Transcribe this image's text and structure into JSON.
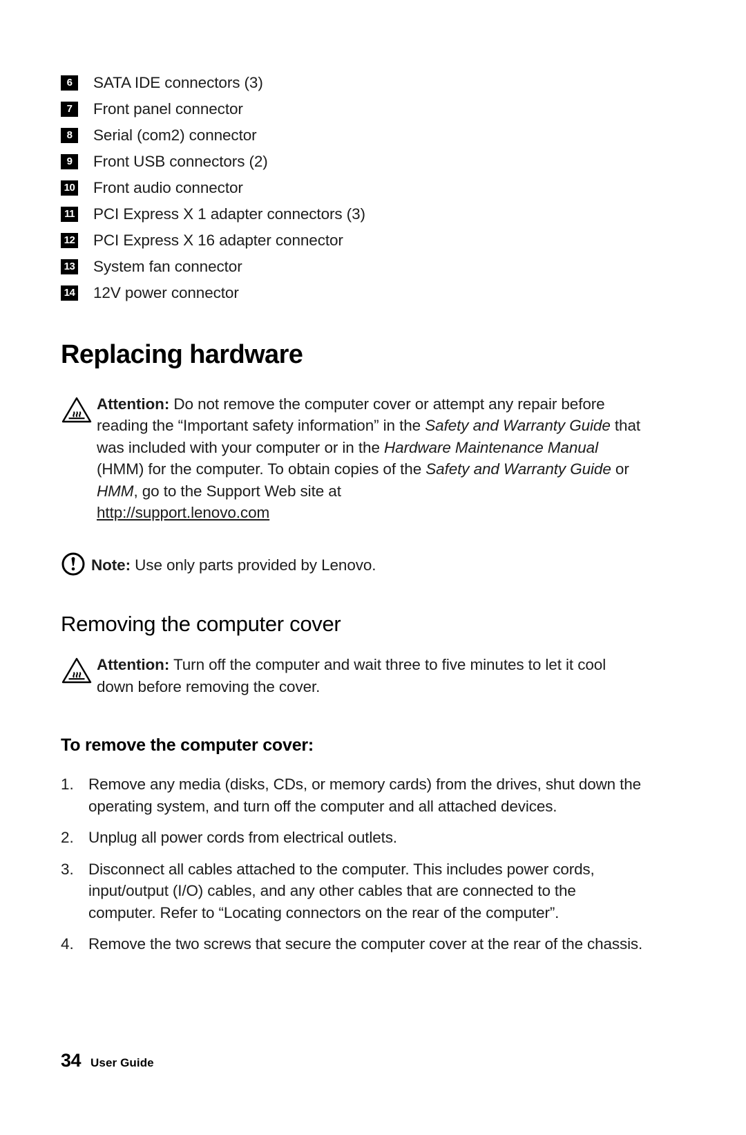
{
  "document": {
    "legend_items": [
      {
        "num": "6",
        "label": "SATA IDE connectors (3)"
      },
      {
        "num": "7",
        "label": "Front panel connector"
      },
      {
        "num": "8",
        "label": "Serial (com2) connector"
      },
      {
        "num": "9",
        "label": "Front USB connectors (2)"
      },
      {
        "num": "10",
        "label": "Front audio connector"
      },
      {
        "num": "11",
        "label": "PCI Express X 1 adapter connectors (3)"
      },
      {
        "num": "12",
        "label": "PCI Express X 16 adapter connector"
      },
      {
        "num": "13",
        "label": "System fan connector"
      },
      {
        "num": "14",
        "label": "12V power connector"
      }
    ],
    "section_title": "Replacing hardware",
    "attention_1": {
      "label": "Attention:",
      "text_1": " Do not remove the computer cover or attempt any repair before reading the “Important safety information” in the ",
      "italic_1": "Safety and Warranty Guide",
      "text_2": " that was included with your computer or in the ",
      "italic_2": "Hardware Maintenance Manual",
      "text_3": " (HMM) for the computer. To obtain copies of the ",
      "italic_3": "Safety and Warranty Guide",
      "text_4": " or ",
      "italic_4": "HMM",
      "text_5": ", go to the Support Web site at ",
      "url": "http://support.lenovo.com"
    },
    "note": {
      "label": "Note:",
      "text": " Use only parts provided by Lenovo."
    },
    "subsection_title": "Removing the computer cover",
    "attention_2": {
      "label": "Attention:",
      "text": " Turn off the computer and wait three to five minutes to let it cool down before removing the cover."
    },
    "task_title": "To remove the computer cover:",
    "steps": [
      {
        "num": "1.",
        "text": "Remove any media (disks, CDs, or memory cards) from the drives, shut down the operating system, and turn off the computer and all attached devices."
      },
      {
        "num": "2.",
        "text": "Unplug all power cords from electrical outlets."
      },
      {
        "num": "3.",
        "text": "Disconnect all cables attached to the computer. This includes power cords, input/output (I/O) cables, and any other cables that are connected to the computer. Refer to “Locating connectors on the rear of the computer”."
      },
      {
        "num": "4.",
        "text": "Remove the two screws that secure the computer cover at the rear of the chassis."
      }
    ],
    "footer": {
      "page_number": "34",
      "label": "User Guide"
    },
    "icons": {
      "hot_surface": "hot-surface-warning-icon",
      "note": "note-exclamation-icon"
    },
    "colors": {
      "text": "#1c1c1c",
      "badge_background": "#000000",
      "badge_text": "#ffffff",
      "page_background": "#ffffff"
    }
  }
}
